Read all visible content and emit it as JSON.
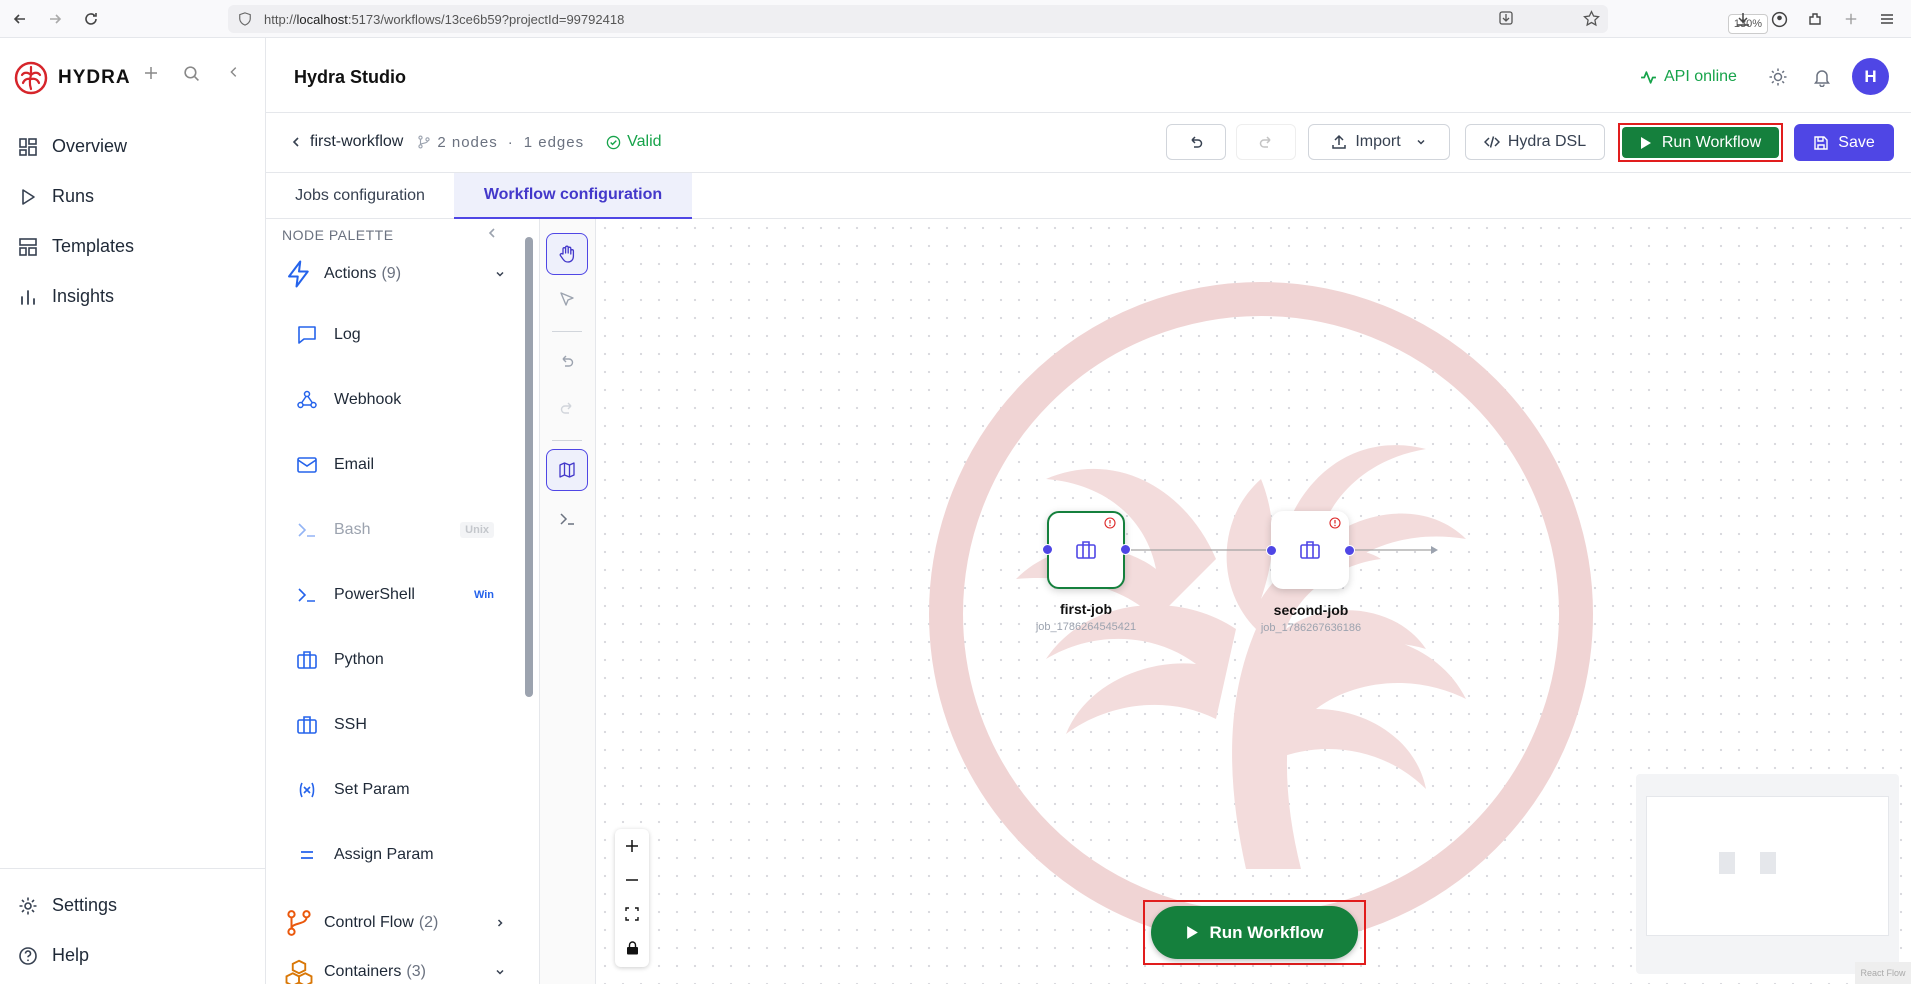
{
  "browser": {
    "url_prefix": "http://",
    "url_host": "localhost",
    "url_rest": ":5173/workflows/13ce6b59?projectId=99792418",
    "zoom": "130%"
  },
  "sidebar": {
    "brand": "HYDRA",
    "nav": [
      {
        "label": "Overview",
        "icon": "grid-icon"
      },
      {
        "label": "Runs",
        "icon": "play-icon"
      },
      {
        "label": "Templates",
        "icon": "layout-icon"
      },
      {
        "label": "Insights",
        "icon": "bar-chart-icon"
      }
    ],
    "bottom": [
      {
        "label": "Settings",
        "icon": "gear-icon"
      },
      {
        "label": "Help",
        "icon": "help-icon"
      }
    ]
  },
  "header": {
    "title": "Hydra Studio",
    "api_status": "API online",
    "avatar_initial": "H"
  },
  "toolbar": {
    "workflow_name": "first-workflow",
    "nodes_count": "2 nodes",
    "separator": "·",
    "edges_count": "1 edges",
    "valid_label": "Valid",
    "import_label": "Import",
    "dsl_label": "Hydra DSL",
    "run_label": "Run Workflow",
    "save_label": "Save"
  },
  "tabs": [
    {
      "label": "Jobs configuration",
      "active": false
    },
    {
      "label": "Workflow configuration",
      "active": true
    }
  ],
  "palette": {
    "title": "NODE PALETTE",
    "groups": [
      {
        "label": "Actions",
        "count": "(9)",
        "expanded": true
      },
      {
        "label": "Control Flow",
        "count": "(2)",
        "expanded": false
      },
      {
        "label": "Containers",
        "count": "(3)",
        "expanded": true
      }
    ],
    "items": [
      {
        "label": "Log",
        "icon": "message-square-icon",
        "tag": "",
        "disabled": false
      },
      {
        "label": "Webhook",
        "icon": "webhook-icon",
        "tag": "",
        "disabled": false
      },
      {
        "label": "Email",
        "icon": "mail-icon",
        "tag": "",
        "disabled": false
      },
      {
        "label": "Bash",
        "icon": "terminal-icon",
        "tag": "Unix",
        "disabled": true
      },
      {
        "label": "PowerShell",
        "icon": "terminal-icon",
        "tag": "Win",
        "disabled": false
      },
      {
        "label": "Python",
        "icon": "briefcase-icon",
        "tag": "",
        "disabled": false
      },
      {
        "label": "SSH",
        "icon": "briefcase-icon",
        "tag": "",
        "disabled": false
      },
      {
        "label": "Set Param",
        "icon": "variable-icon",
        "tag": "",
        "disabled": false
      },
      {
        "label": "Assign Param",
        "icon": "equals-icon",
        "tag": "",
        "disabled": false
      }
    ]
  },
  "canvas": {
    "nodes": [
      {
        "label": "first-job",
        "id": "job_1786264545421",
        "selected": true
      },
      {
        "label": "second-job",
        "id": "job_1786267636186",
        "selected": false
      }
    ],
    "run_label": "Run Workflow",
    "corner_text": "React Flow"
  },
  "colors": {
    "accent": "#4f46e5",
    "success": "#15803d",
    "highlight_box": "#e11d1d",
    "watermark": "#f0d4d4"
  }
}
